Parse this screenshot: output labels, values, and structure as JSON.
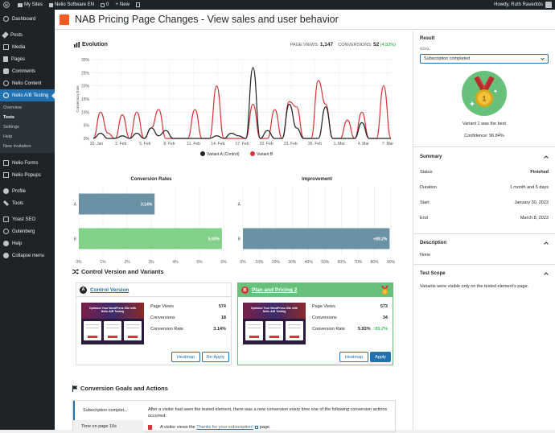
{
  "admin_bar": {
    "my_sites": "My Sites",
    "site": "Nelio Software EN",
    "comments": "0",
    "new": "New",
    "greeting": "Howdy, Ruth Raventós"
  },
  "menu": {
    "items": [
      {
        "label": "Dashboard",
        "icon": "dashboard-icon"
      },
      {
        "label": "Posts",
        "icon": "pin-icon"
      },
      {
        "label": "Media",
        "icon": "media-icon"
      },
      {
        "label": "Pages",
        "icon": "page-icon"
      },
      {
        "label": "Comments",
        "icon": "comment-icon"
      },
      {
        "label": "Nelio Content",
        "icon": "nelio-icon"
      },
      {
        "label": "Nelio A/B Testing",
        "icon": "nelio-ab-icon"
      },
      {
        "label": "Nelio Forms",
        "icon": "forms-icon"
      },
      {
        "label": "Nelio Popups",
        "icon": "popups-icon"
      },
      {
        "label": "Profile",
        "icon": "user-icon"
      },
      {
        "label": "Tools",
        "icon": "wrench-icon"
      },
      {
        "label": "Yoast SEO",
        "icon": "yoast-icon"
      },
      {
        "label": "Gutenberg",
        "icon": "gutenberg-icon"
      },
      {
        "label": "Help",
        "icon": "help-icon"
      },
      {
        "label": "Collapse menu",
        "icon": "collapse-icon"
      }
    ],
    "submenu": [
      "Overview",
      "Tests",
      "Settings",
      "Help",
      "New Invitation"
    ]
  },
  "page_title": "NAB Pricing Page Changes - View sales and user behavior",
  "evolution": {
    "title": "Evolution",
    "page_views_label": "PAGE VIEWS:",
    "page_views": "1,147",
    "conversions_label": "CONVERSIONS:",
    "conversions": "52",
    "conversion_pct": "(4.53%)"
  },
  "colors": {
    "control": "#1d2327",
    "variant": "#d63638",
    "bar_a": "#6b91a4",
    "bar_b": "#83d088",
    "accent": "#2271b1",
    "medal_bg": "#68c17b"
  },
  "chart_data": [
    {
      "type": "line",
      "title": "",
      "ylabel": "Conversion Rate",
      "ylim": [
        0,
        30
      ],
      "yticks": [
        "0%",
        "5%",
        "10%",
        "15%",
        "20%",
        "25%",
        "30%"
      ],
      "x": [
        "30. Jan",
        "2. Feb",
        "5. Feb",
        "8. Feb",
        "11. Feb",
        "14. Feb",
        "17. Feb",
        "20. Feb",
        "23. Feb",
        "26. Feb",
        "1. Mar",
        "4. Mar",
        "7. Mar"
      ],
      "grid": true,
      "legend": "bottom",
      "series": [
        {
          "name": "Variant A (Control)",
          "values": [
            0,
            2,
            0,
            0,
            1,
            0,
            2,
            0,
            4,
            1,
            3,
            0,
            0,
            0,
            0,
            0,
            0,
            1,
            0,
            2,
            1,
            0,
            27,
            0,
            3,
            0,
            0,
            13,
            4,
            0,
            0,
            0,
            12,
            0,
            0,
            0,
            0,
            6,
            0,
            0,
            0,
            0
          ]
        },
        {
          "name": "Variant B",
          "values": [
            0,
            10,
            2,
            0,
            9,
            0,
            10,
            0,
            4,
            11,
            0,
            0,
            0,
            0,
            11,
            0,
            0,
            20,
            0,
            0,
            0,
            0,
            13,
            0,
            0,
            11,
            0,
            14,
            12,
            0,
            0,
            22,
            13,
            0,
            0,
            7,
            0,
            10,
            0,
            0,
            20,
            0
          ]
        }
      ]
    },
    {
      "type": "bar",
      "title": "Conversion Rates",
      "categories": [
        "A",
        "B"
      ],
      "values": [
        3.14,
        5.93
      ],
      "value_labels": [
        "3.14%",
        "5.93%"
      ],
      "xlim": [
        0,
        6
      ],
      "xticks": [
        "0%",
        "1%",
        "2%",
        "3%",
        "4%",
        "5%",
        "6%"
      ]
    },
    {
      "type": "bar",
      "title": "Improvement",
      "categories": [
        "A",
        "B"
      ],
      "values": [
        0,
        89.2
      ],
      "value_labels": [
        "",
        "+89.2%"
      ],
      "xlim": [
        0,
        90
      ],
      "xticks": [
        "0%",
        "10%",
        "20%",
        "30%",
        "40%",
        "50%",
        "60%",
        "70%",
        "80%",
        "90%"
      ]
    }
  ],
  "control_section": {
    "title": "Control Version and Variants",
    "variant_a": {
      "badge": "A",
      "name": "Control Version",
      "page_views_label": "Page Views",
      "page_views": "574",
      "conversions_label": "Conversions",
      "conversions": "18",
      "rate_label": "Conversion Rate",
      "rate": "3.14%",
      "btn_heatmap": "Heatmap",
      "btn_reapply": "Re-Apply",
      "thumb_text": "Optimize Your WordPress Site with Nelio A/B Testing"
    },
    "variant_b": {
      "badge": "B",
      "name": "Plan and Pricing 2",
      "page_views_label": "Page Views",
      "page_views": "573",
      "conversions_label": "Conversions",
      "conversions": "34",
      "rate_label": "Conversion Rate",
      "rate": "5.93%",
      "improvement": "↑89.2%",
      "btn_heatmap": "Heatmap",
      "btn_apply": "Apply",
      "thumb_text": "Optimize Your WordPress Site with Nelio A/B Testing"
    }
  },
  "goals": {
    "title": "Conversion Goals and Actions",
    "tab_1": "Subscription complet...",
    "tab_2": "Time on page 10s",
    "description": "After a visitor had seen the tested element, there was a new conversion every time one of the following conversion actions occurred:",
    "action_prefix": "A visitor views the",
    "action_link": "Thanks for your subscription!",
    "action_suffix": "page."
  },
  "result": {
    "title": "Result",
    "goal_label": "GOAL",
    "goal_value": "Subscription completed",
    "winner": "Variant 1 was the best",
    "confidence": "Confidence: 96.84%"
  },
  "summary": {
    "title": "Summary",
    "status_label": "Status",
    "status": "Finished",
    "duration_label": "Duration",
    "duration": "1 month and 5 days",
    "start_label": "Start",
    "start": "January 30, 2023",
    "end_label": "End",
    "end": "March 8, 2023"
  },
  "description": {
    "title": "Description",
    "text": "None"
  },
  "scope": {
    "title": "Test Scope",
    "text": "Variants were visible only on the tested element's page."
  }
}
